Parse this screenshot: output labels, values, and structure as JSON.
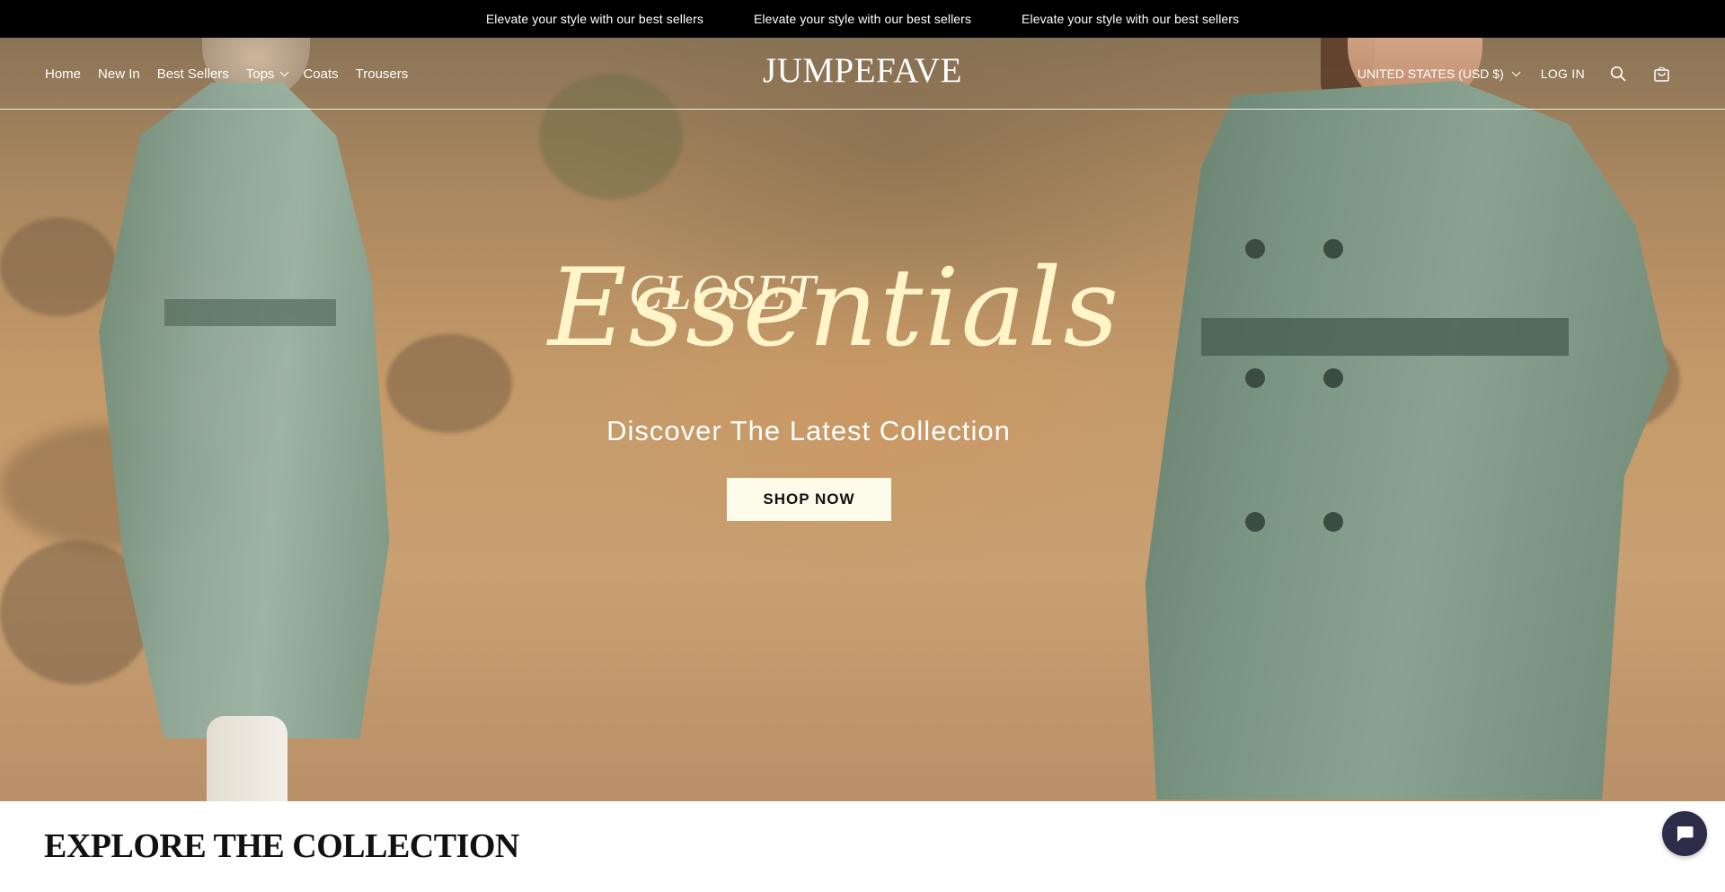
{
  "announcement": {
    "messages": [
      "Elevate your style with our best sellers",
      "Elevate your style with our best sellers",
      "Elevate your style with our best sellers"
    ]
  },
  "header": {
    "logo": "JUMPEFAVE",
    "nav": [
      {
        "label": "Home"
      },
      {
        "label": "New In"
      },
      {
        "label": "Best Sellers"
      },
      {
        "label": "Tops",
        "has_dropdown": true
      },
      {
        "label": "Coats"
      },
      {
        "label": "Trousers"
      }
    ],
    "country_selector": "UNITED STATES (USD $)",
    "login": "LOG IN",
    "icons": [
      "search-icon",
      "cart-icon",
      "chevron-down-icon"
    ]
  },
  "hero": {
    "script_small": "CLOSET",
    "script_large": "Essentials",
    "tagline": "Discover The Latest Collection",
    "cta": "SHOP NOW"
  },
  "section": {
    "title": "EXPLORE THE COLLECTION"
  },
  "chat": {
    "icon": "chat-icon"
  },
  "colors": {
    "announcement_bg": "#000000",
    "cta_bg": "#fdfbe9",
    "script_text": "#fff5c8",
    "chat_bg": "#2d2d4a"
  }
}
